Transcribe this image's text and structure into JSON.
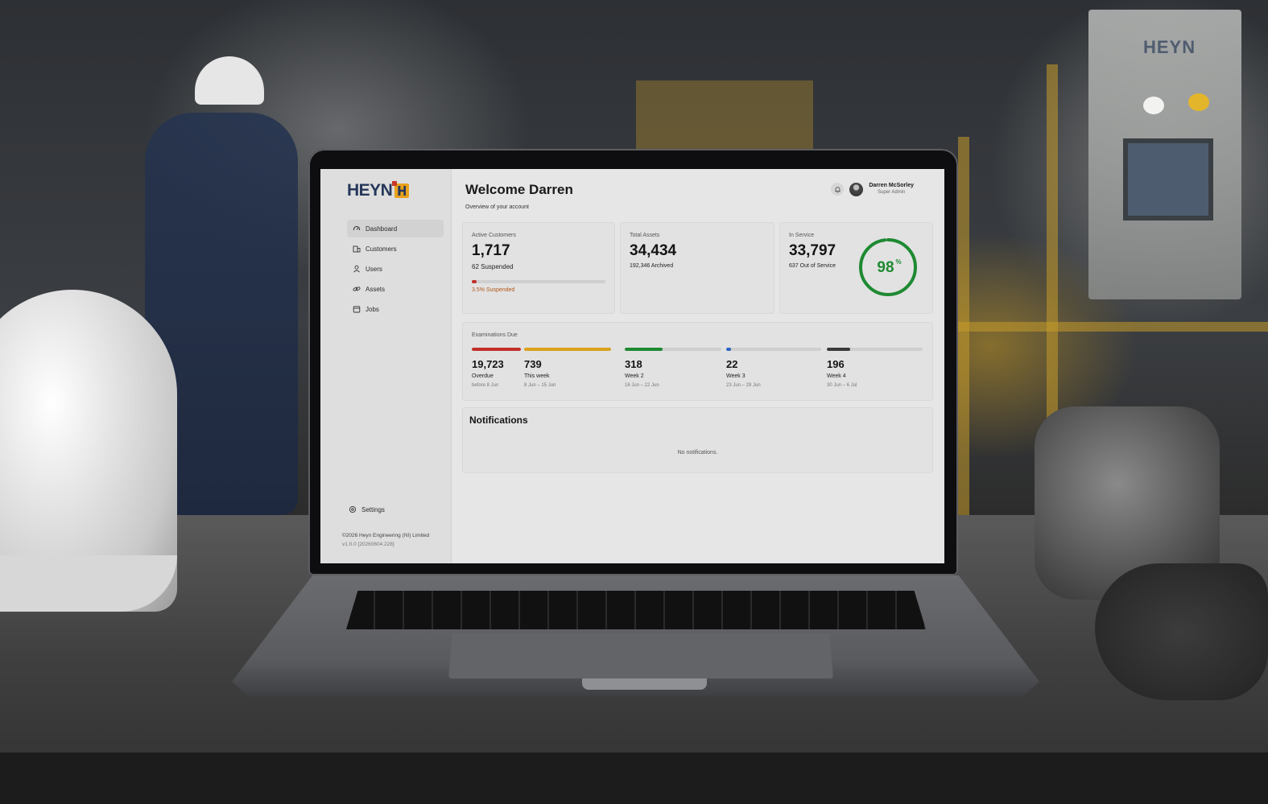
{
  "brand": {
    "logo_text": "HEYN"
  },
  "sidebar": {
    "items": [
      {
        "label": "Dashboard",
        "icon": "gauge-icon",
        "active": true
      },
      {
        "label": "Customers",
        "icon": "building-icon"
      },
      {
        "label": "Users",
        "icon": "user-icon"
      },
      {
        "label": "Assets",
        "icon": "link-icon"
      },
      {
        "label": "Jobs",
        "icon": "calendar-icon"
      }
    ],
    "settings_label": "Settings",
    "copyright": "©2026 Heyn Engineering (NI) Limited",
    "version": "v1.0.0 [20260604.228]"
  },
  "header": {
    "title": "Welcome Darren",
    "subtitle": "Overview of your account",
    "user_name": "Darren McSorley",
    "user_role": "Super Admin"
  },
  "stats": {
    "active_customers": {
      "label": "Active Customers",
      "value": "1,717",
      "sub": "62 Suspended",
      "progress_pct": 3.5,
      "note": "3.5% Suspended"
    },
    "total_assets": {
      "label": "Total Assets",
      "value": "34,434",
      "sub": "192,346 Archived"
    },
    "in_service": {
      "label": "In Service",
      "value": "33,797",
      "sub": "637 Out of Service",
      "percent": 98,
      "percent_text": "98",
      "percent_sign": "%"
    }
  },
  "examinations": {
    "title": "Examinations Due",
    "columns": [
      {
        "value": "19,723",
        "name": "Overdue",
        "date": "before 8 Jun",
        "fill": 1.0,
        "color": "#c22f2a"
      },
      {
        "value": "739",
        "name": "This week",
        "date": "8 Jun – 15 Jun",
        "fill": 1.0,
        "color": "#d9a21b"
      },
      {
        "value": "318",
        "name": "Week 2",
        "date": "16 Jun – 22 Jun",
        "fill": 0.39,
        "color": "#1e8a32"
      },
      {
        "value": "22",
        "name": "Week 3",
        "date": "23 Jun – 29 Jun",
        "fill": 0.05,
        "color": "#2a62c4"
      },
      {
        "value": "196",
        "name": "Week 4",
        "date": "30 Jun – 6 Jul",
        "fill": 0.24,
        "color": "#3a3a3a"
      }
    ]
  },
  "notifications": {
    "title": "Notifications",
    "empty_text": "No notifications."
  },
  "colors": {
    "accent_navy": "#26375a",
    "brand_orange": "#e8a21a",
    "ring_green": "#1e8a32",
    "danger_red": "#c22f2a"
  }
}
